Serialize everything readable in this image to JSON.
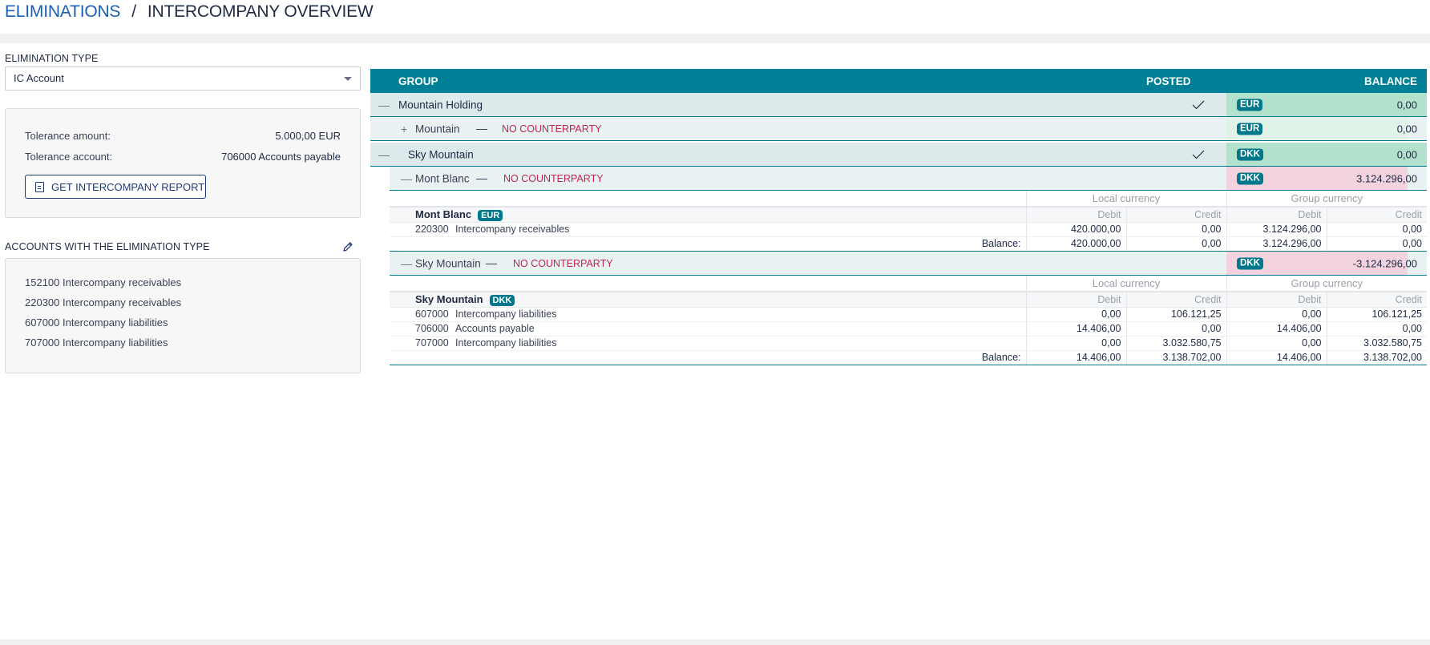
{
  "breadcrumb": {
    "parent": "ELIMINATIONS",
    "separator": "/",
    "current": "INTERCOMPANY OVERVIEW"
  },
  "left_panel": {
    "elimination_type_label": "ELIMINATION TYPE",
    "elimination_type_value": "IC Account",
    "tolerance_amount_label": "Tolerance amount:",
    "tolerance_amount_value": "5.000,00 EUR",
    "tolerance_account_label": "Tolerance account:",
    "tolerance_account_value": "706000 Accounts payable",
    "report_button": "GET INTERCOMPANY REPORT",
    "accounts_label": "ACCOUNTS WITH THE ELIMINATION TYPE",
    "accounts": [
      "152100 Intercompany receivables",
      "220300 Intercompany receivables",
      "607000 Intercompany liabilities",
      "707000 Intercompany liabilities"
    ]
  },
  "grid": {
    "headers": {
      "group": "GROUP",
      "posted": "POSTED",
      "balance": "BALANCE"
    },
    "rows": [
      {
        "level": 1,
        "toggle": "—",
        "name": "Mountain Holding",
        "posted": true,
        "currency": "EUR",
        "balance": "0,00",
        "status": "balanced"
      },
      {
        "level": 2,
        "toggle": "+",
        "name": "Mountain",
        "counterparty": "NO COUNTERPARTY",
        "currency": "EUR",
        "balance": "0,00",
        "status": "balanced-light"
      },
      {
        "level": 1,
        "toggle": "—",
        "name": "Sky Mountain",
        "posted": true,
        "currency": "DKK",
        "balance": "0,00",
        "status": "balanced"
      },
      {
        "level": 2,
        "toggle": "—",
        "name": "Mont Blanc",
        "counterparty": "NO COUNTERPARTY",
        "currency": "DKK",
        "balance": "3.124.296,00",
        "status": "unbalanced"
      },
      {
        "level": 2,
        "toggle": "—",
        "name": "Sky Mountain",
        "counterparty": "NO COUNTERPARTY",
        "currency": "DKK",
        "balance": "-3.124.296,00",
        "status": "unbalanced"
      }
    ],
    "details": [
      {
        "local_currency": "Local currency",
        "group_currency": "Group currency",
        "entity": "Mont Blanc",
        "entity_currency": "EUR",
        "cols": [
          "Debit",
          "Credit",
          "Debit",
          "Credit"
        ],
        "lines": [
          {
            "account": "220300",
            "name": "Intercompany receivables",
            "values": [
              "420.000,00",
              "0,00",
              "3.124.296,00",
              "0,00"
            ]
          }
        ],
        "balance_label": "Balance:",
        "balance": [
          "420.000,00",
          "0,00",
          "3.124.296,00",
          "0,00"
        ]
      },
      {
        "local_currency": "Local currency",
        "group_currency": "Group currency",
        "entity": "Sky Mountain",
        "entity_currency": "DKK",
        "cols": [
          "Debit",
          "Credit",
          "Debit",
          "Credit"
        ],
        "lines": [
          {
            "account": "607000",
            "name": "Intercompany liabilities",
            "values": [
              "0,00",
              "106.121,25",
              "0,00",
              "106.121,25"
            ]
          },
          {
            "account": "706000",
            "name": "Accounts payable",
            "values": [
              "14.406,00",
              "0,00",
              "14.406,00",
              "0,00"
            ]
          },
          {
            "account": "707000",
            "name": "Intercompany liabilities",
            "values": [
              "0,00",
              "3.032.580,75",
              "0,00",
              "3.032.580,75"
            ]
          }
        ],
        "balance_label": "Balance:",
        "balance": [
          "14.406,00",
          "3.138.702,00",
          "14.406,00",
          "3.138.702,00"
        ]
      }
    ]
  },
  "colors": {
    "brand_teal": "#008096",
    "balanced_green": "#b2e2cb",
    "balanced_light": "#e1f3e8",
    "unbalanced_pink": "#f3d3de",
    "warning_red": "#c2264f",
    "link_blue": "#1a5fb4"
  },
  "icons": {
    "pencil": "edit-pencil-icon",
    "report": "document-icon",
    "check": "checkmark-icon",
    "caret": "chevron-down-icon"
  }
}
